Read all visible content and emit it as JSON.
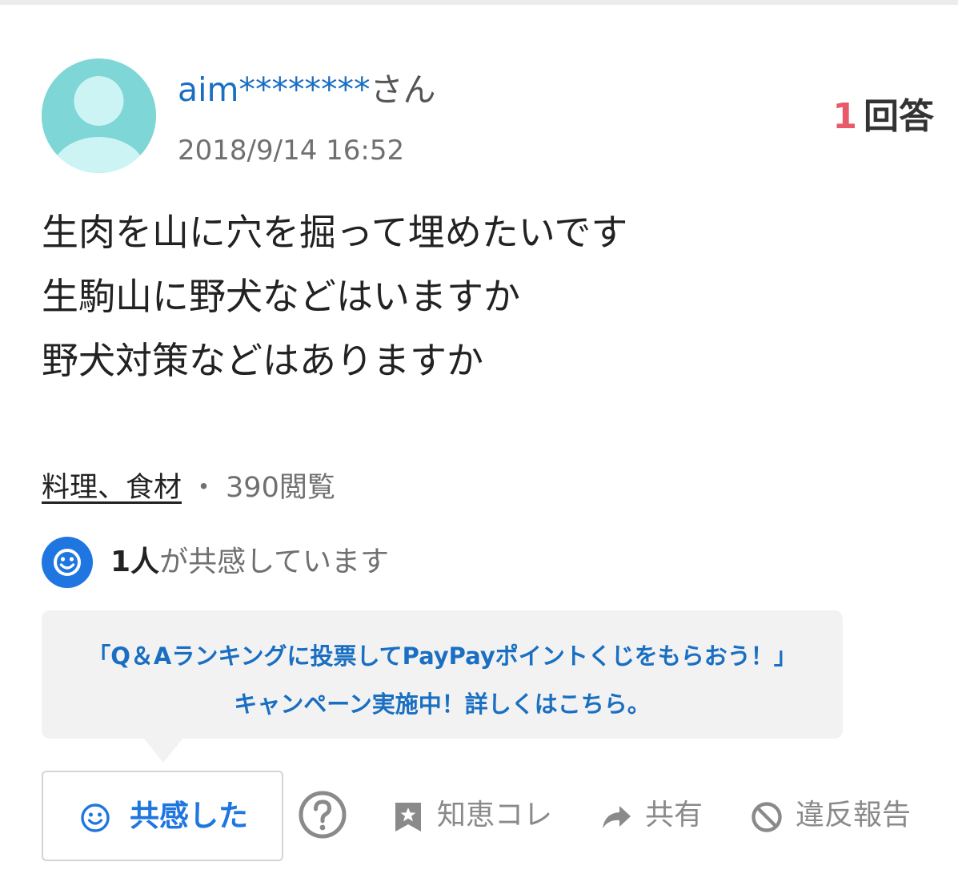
{
  "header": {
    "user_id": "aim********",
    "user_suffix": "さん",
    "posted_at": "2018/9/14 16:52",
    "answer_count": "1",
    "answer_label": "回答"
  },
  "question": {
    "lines": [
      "生肉を山に穴を掘って埋めたいです",
      "生駒山に野犬などはいますか",
      "野犬対策などはありますか"
    ]
  },
  "meta": {
    "category": "料理、食材",
    "separator": "・",
    "views": "390閲覧"
  },
  "empathy": {
    "count": "1人",
    "text": "が共感しています"
  },
  "campaign": {
    "line1": "「Q＆Aランキングに投票してPayPayポイントくじをもらおう！」",
    "line2": "キャンペーン実施中！詳しくはこちら。"
  },
  "actions": {
    "empathize_label": "共感した",
    "bookmark_label": "知恵コレ",
    "share_label": "共有",
    "report_label": "違反報告"
  },
  "icons": {
    "avatar": "default-user-avatar-icon",
    "empathy": "smile-icon",
    "help": "question-circle-icon",
    "bookmark": "bookmark-star-icon",
    "share": "share-arrow-icon",
    "report": "prohibited-icon"
  },
  "colors": {
    "link_blue": "#1a6fc2",
    "accent_blue": "#1f76e0",
    "answer_red": "#e85a6a",
    "avatar_teal": "#7fd6d6",
    "muted_gray": "#8a8a8a"
  }
}
